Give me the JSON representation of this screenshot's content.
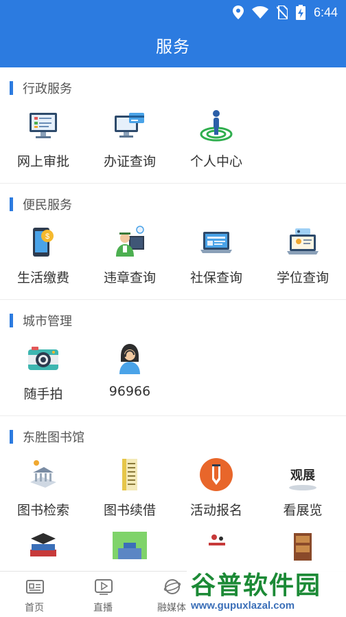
{
  "status_bar": {
    "time": "6:44"
  },
  "header": {
    "title": "服务"
  },
  "sections": [
    {
      "title": "行政服务",
      "items": [
        {
          "label": "网上审批",
          "icon": "computer-approval-icon"
        },
        {
          "label": "办证查询",
          "icon": "card-query-icon"
        },
        {
          "label": "个人中心",
          "icon": "person-target-icon"
        }
      ]
    },
    {
      "title": "便民服务",
      "items": [
        {
          "label": "生活缴费",
          "icon": "phone-payment-icon"
        },
        {
          "label": "违章查询",
          "icon": "traffic-officer-icon"
        },
        {
          "label": "社保查询",
          "icon": "laptop-insurance-icon"
        },
        {
          "label": "学位查询",
          "icon": "laptop-profile-icon"
        }
      ]
    },
    {
      "title": "城市管理",
      "items": [
        {
          "label": "随手拍",
          "icon": "camera-icon"
        },
        {
          "label": "96966",
          "icon": "hotline-operator-icon"
        }
      ]
    },
    {
      "title": "东胜图书馆",
      "items": [
        {
          "label": "图书检索",
          "icon": "library-search-icon"
        },
        {
          "label": "图书续借",
          "icon": "book-renew-icon"
        },
        {
          "label": "活动报名",
          "icon": "pencil-badge-icon"
        },
        {
          "label": "看展览",
          "icon": "exhibition-sign-icon"
        }
      ]
    }
  ],
  "bottom_nav": [
    {
      "label": "首页",
      "icon": "news-icon"
    },
    {
      "label": "直播",
      "icon": "play-icon"
    },
    {
      "label": "融媒体",
      "icon": "globe-icon"
    }
  ],
  "watermark": {
    "title": "谷普软件园",
    "url": "www.gupuxlazal.com"
  },
  "colors": {
    "primary": "#2c7be0",
    "background": "#ffffff"
  }
}
